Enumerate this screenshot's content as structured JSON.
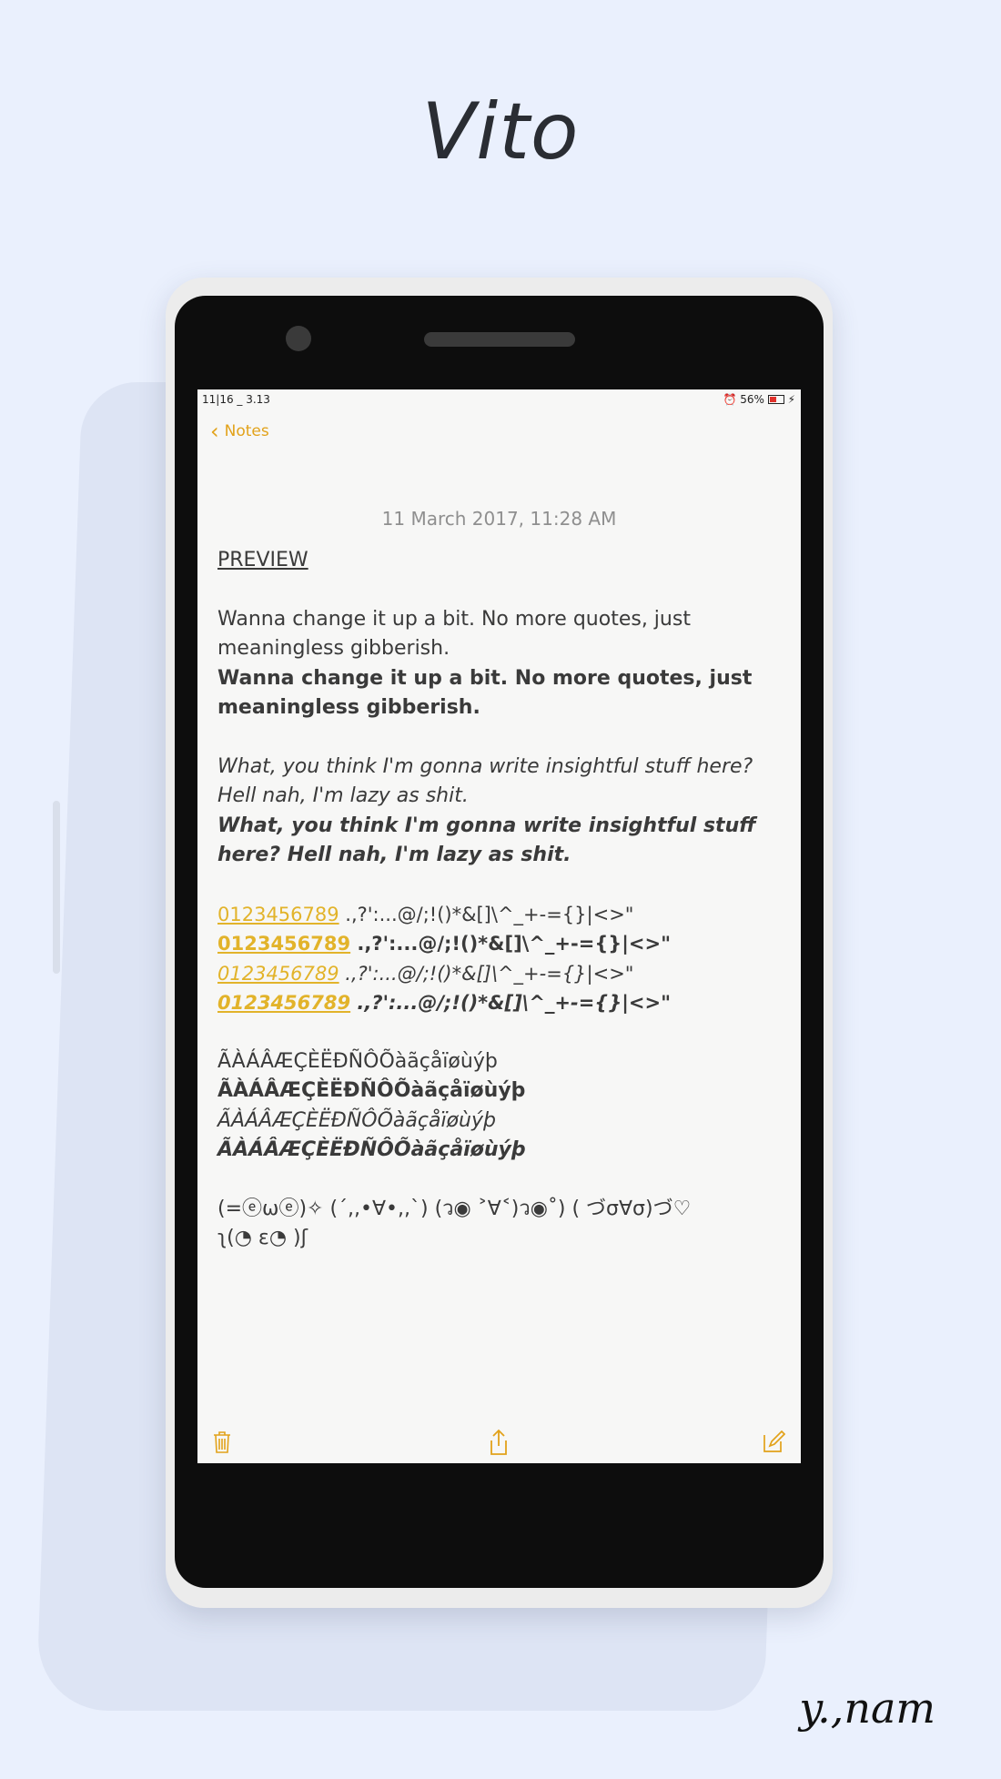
{
  "title": "Vito",
  "signature": "y.,nam",
  "status_bar": {
    "time": "11|16 _ 3.13",
    "battery": "56%"
  },
  "nav": {
    "back_label": "Notes"
  },
  "note": {
    "timestamp": "11 March 2017, 11:28 AM",
    "heading": "PREVIEW",
    "line1_regular": "Wanna change it up a bit. No more quotes, just meaningless gibberish.",
    "line1_bold": "Wanna change it up a bit. No more quotes, just meaningless gibberish.",
    "line2_italic": "What, you think I'm gonna write insightful stuff here? Hell nah, I'm lazy as shit.",
    "line2_bold_italic": "What, you think I'm gonna write insightful stuff here? Hell nah, I'm lazy as shit.",
    "digits": "0123456789",
    "symbols": " .,?':...@/;!()*&[]\\^_+-={}|<>\"",
    "accents": "ÃÀÁÂÆÇÈËÐÑÔÕàãçåïøùýþ",
    "emoticons_1": "(=ⓔωⓔ)✧ (´,,•∀•,,`) (ว◉ ˃∀˂)ว◉˚) ( づσ∀σ)づ♡",
    "emoticons_2": "ʅ(◔ ε◔ )ʃ"
  },
  "toolbar": {
    "delete_icon": "trash-icon",
    "share_icon": "share-icon",
    "compose_icon": "compose-icon"
  },
  "colors": {
    "accent": "#e2a21a",
    "link": "#e2b32a",
    "background": "#eaf0fd"
  }
}
